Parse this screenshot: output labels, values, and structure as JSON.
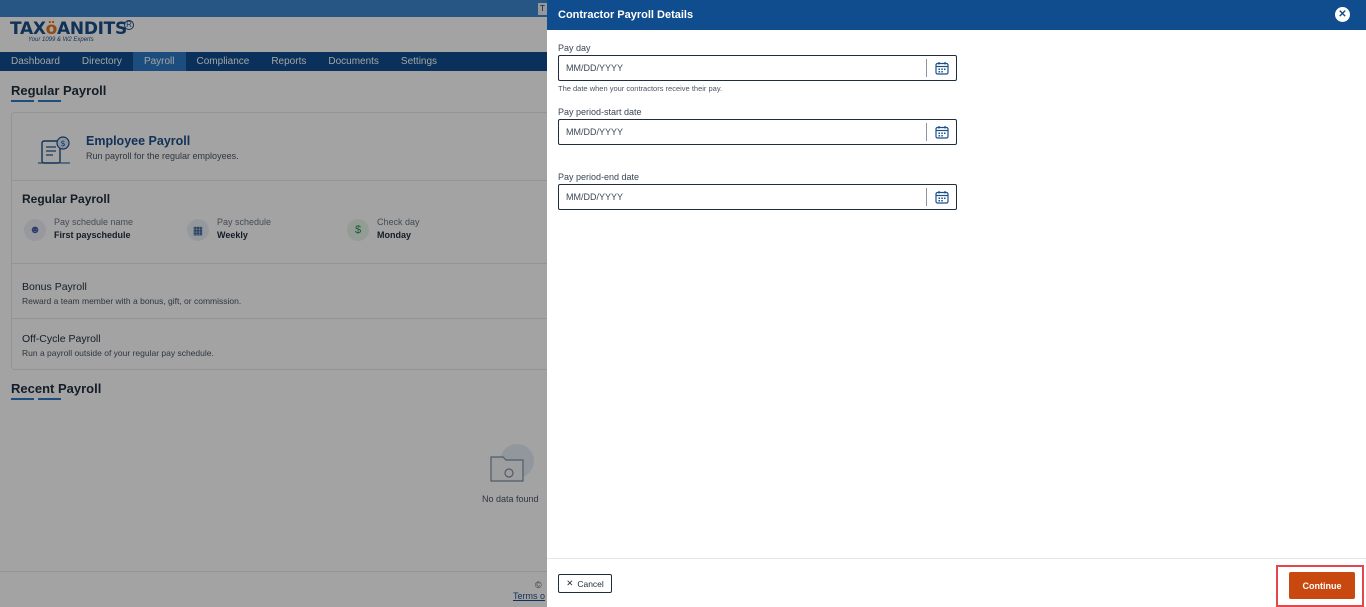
{
  "top_bar": {
    "tab_stub": "T"
  },
  "brand": {
    "name_start": "TAX",
    "name_owl": "ö",
    "name_end": "ANDITS",
    "reg": "R",
    "tagline": "Your 1099 & W2 Experts"
  },
  "nav": {
    "items": [
      {
        "label": "Dashboard"
      },
      {
        "label": "Directory"
      },
      {
        "label": "Payroll",
        "active": true
      },
      {
        "label": "Compliance"
      },
      {
        "label": "Reports"
      },
      {
        "label": "Documents"
      },
      {
        "label": "Settings"
      }
    ]
  },
  "main": {
    "title": "Regular Payroll",
    "employee_payroll": {
      "title": "Employee Payroll",
      "subtitle": "Run payroll for the regular employees."
    },
    "regular_payroll": {
      "title": "Regular Payroll",
      "info": [
        {
          "label": "Pay schedule name",
          "value": "First payschedule",
          "icon": "person-icon"
        },
        {
          "label": "Pay schedule",
          "value": "Weekly",
          "icon": "calendar-icon"
        },
        {
          "label": "Check day",
          "value": "Monday",
          "icon": "money-icon"
        }
      ]
    },
    "bonus_payroll": {
      "title": "Bonus Payroll",
      "subtitle": "Reward a team member with a bonus, gift, or commission."
    },
    "off_cycle_payroll": {
      "title": "Off-Cycle Payroll",
      "subtitle": "Run a payroll outside of your regular pay schedule."
    },
    "recent_title": "Recent Payroll",
    "no_data": "No data found",
    "copyright": "©",
    "terms": "Terms o"
  },
  "drawer": {
    "title": "Contractor Payroll Details",
    "fields": {
      "pay_day": {
        "label": "Pay day",
        "placeholder": "MM/DD/YYYY",
        "helper": "The date when your contractors receive their pay."
      },
      "start_date": {
        "label": "Pay period-start date",
        "placeholder": "MM/DD/YYYY"
      },
      "end_date": {
        "label": "Pay period-end date",
        "placeholder": "MM/DD/YYYY"
      }
    },
    "cancel_label": "Cancel",
    "continue_label": "Continue"
  },
  "colors": {
    "header_blue": "#0f4d8f",
    "accent_blue": "#2e79c6",
    "continue_orange": "#c9480f",
    "highlight_red": "#e2474b"
  }
}
